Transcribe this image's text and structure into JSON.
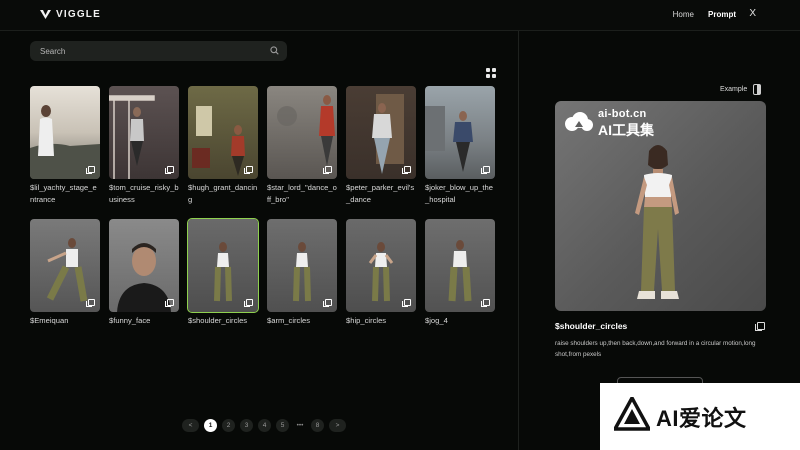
{
  "header": {
    "brand": "VIGGLE",
    "nav": [
      {
        "label": "Home"
      },
      {
        "label": "Prompt"
      }
    ],
    "close": "X"
  },
  "search": {
    "placeholder": "Search"
  },
  "templates": [
    {
      "label": "$lil_yachty_stage_entrance",
      "bg": "#cfc7bb"
    },
    {
      "label": "$tom_cruise_risky_business",
      "bg": "#4a4040"
    },
    {
      "label": "$hugh_grant_dancing",
      "bg": "#5a5236"
    },
    {
      "label": "$star_lord_\"dance_off_bro\"",
      "bg": "#6d6864"
    },
    {
      "label": "$peter_parker_evil's_dance",
      "bg": "#4a3b33"
    },
    {
      "label": "$joker_blow_up_the_hospital",
      "bg": "#8a8f92"
    },
    {
      "label": "$Emeiquan",
      "bg": "#6a6a6a"
    },
    {
      "label": "$funny_face",
      "bg": "#7a7a7a"
    },
    {
      "label": "$shoulder_circles",
      "bg": "#5f5f5f"
    },
    {
      "label": "$arm_circles",
      "bg": "#636363"
    },
    {
      "label": "$hip_circles",
      "bg": "#5f5f5f"
    },
    {
      "label": "$jog_4",
      "bg": "#646464"
    }
  ],
  "pagination": {
    "prev": "<",
    "pages": [
      "1",
      "2",
      "3",
      "4",
      "5"
    ],
    "ellipsis": "•••",
    "last": "8",
    "next": ">",
    "current": "1"
  },
  "detail": {
    "example_label": "Example",
    "title": "$shoulder_circles",
    "description": "raise shoulders up,then back,down,and forward in a circular motion,long shot,from pexels",
    "watermark_line1": "ai-bot.cn",
    "watermark_line2": "AI工具集"
  },
  "badge": {
    "text": "AI爱论文"
  },
  "colors": {
    "accent_selected": "#8fd14f",
    "background": "#070907",
    "panel": "#1f221f"
  }
}
